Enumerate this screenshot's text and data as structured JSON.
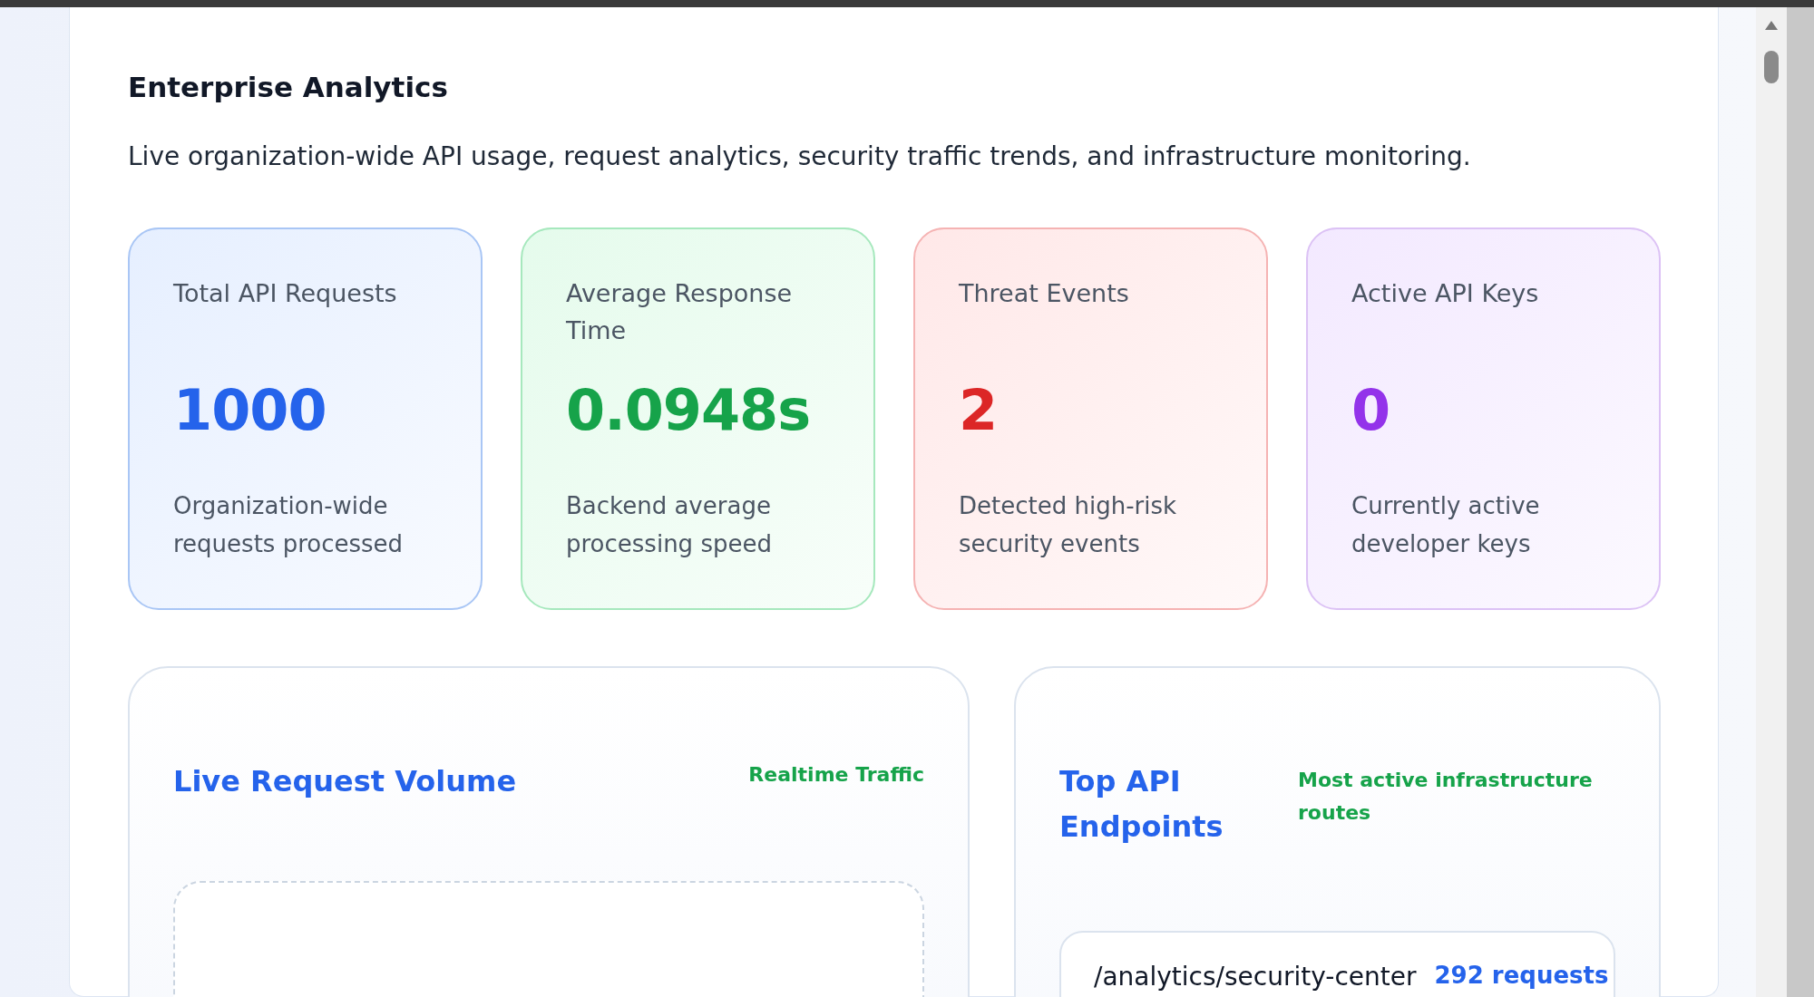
{
  "header": {
    "title": "Enterprise Analytics",
    "subtitle": "Live organization-wide API usage, request analytics, security traffic trends, and infrastructure monitoring."
  },
  "stats": [
    {
      "label": "Total API Requests",
      "value": "1000",
      "description": "Organization-wide requests processed",
      "color": "#2563eb"
    },
    {
      "label": "Average Response Time",
      "value": "0.0948s",
      "description": "Backend average processing speed",
      "color": "#16a34a"
    },
    {
      "label": "Threat Events",
      "value": "2",
      "description": "Detected high-risk security events",
      "color": "#dc2626"
    },
    {
      "label": "Active API Keys",
      "value": "0",
      "description": "Currently active developer keys",
      "color": "#9333ea"
    }
  ],
  "volume_panel": {
    "title": "Live Request Volume",
    "badge": "Realtime Traffic"
  },
  "endpoints_panel": {
    "title": "Top API Endpoints",
    "badge": "Most active infrastructure routes",
    "endpoints": [
      {
        "path": "/analytics/security-center",
        "requests": "292 requests"
      }
    ]
  }
}
